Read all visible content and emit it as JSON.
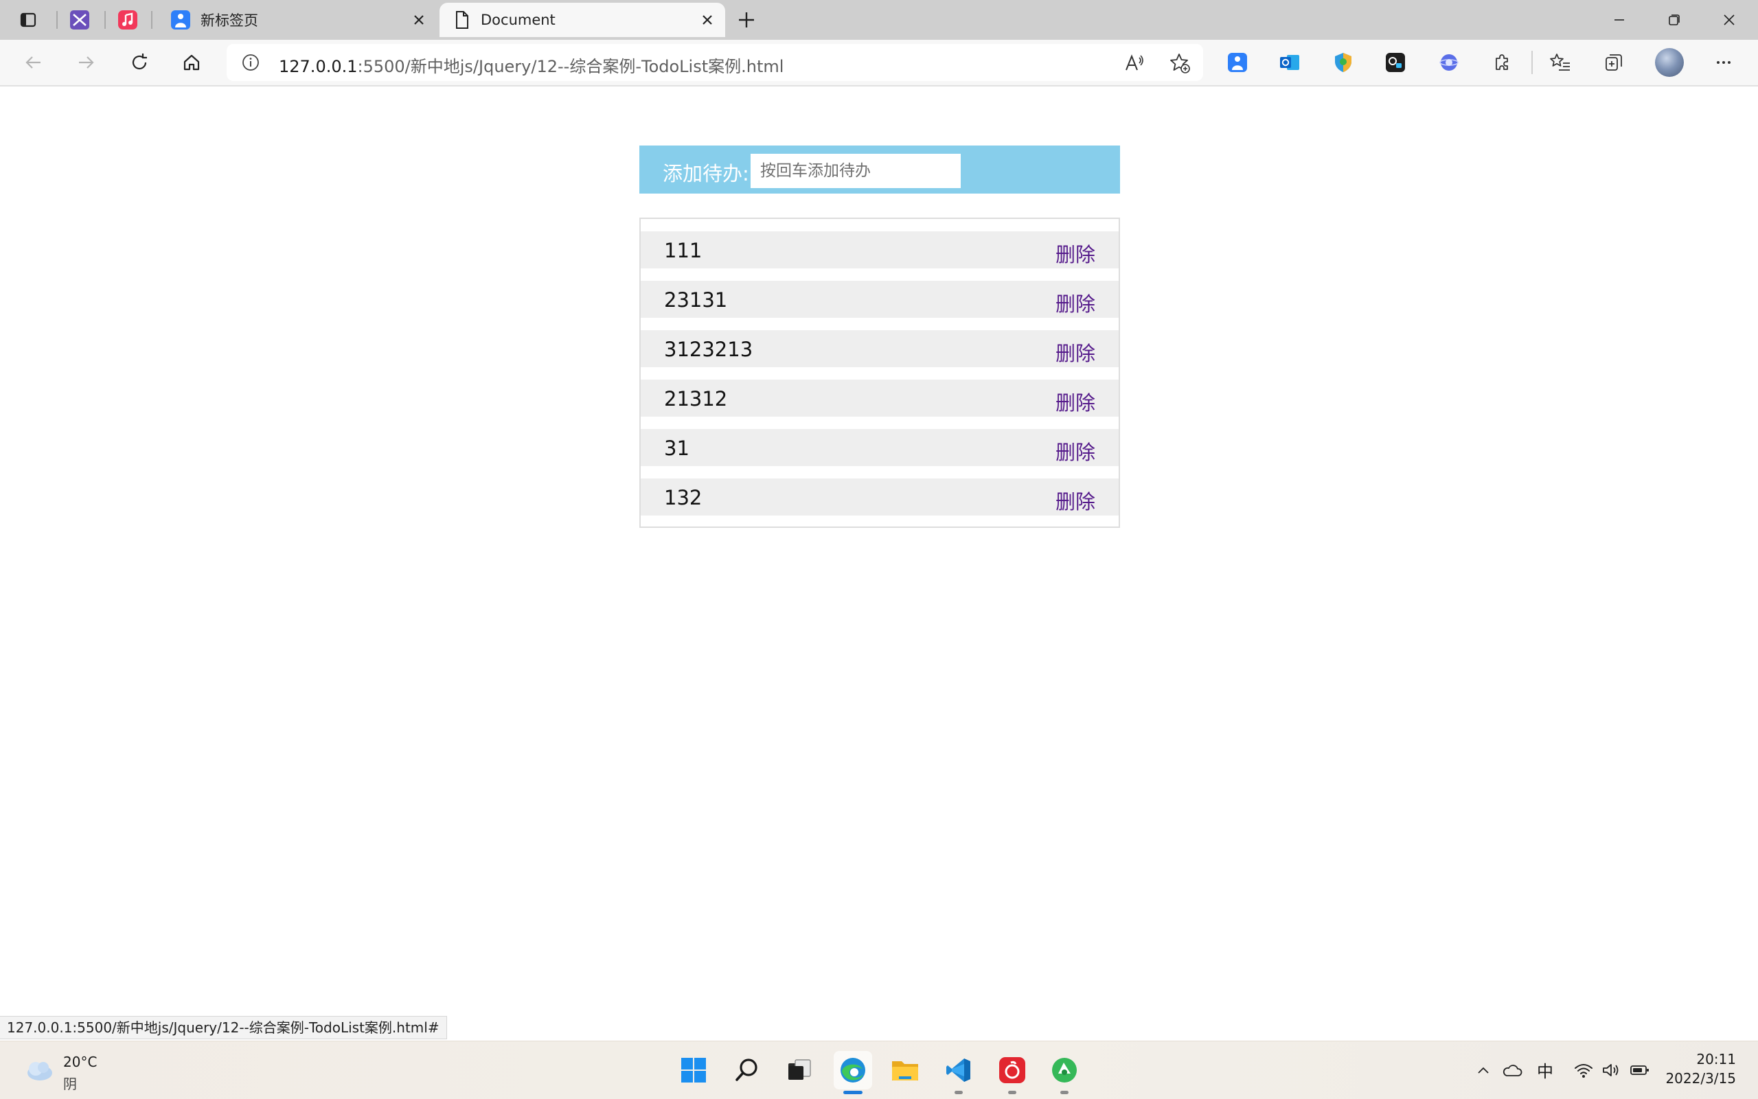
{
  "browser": {
    "tabs": [
      {
        "title": "新标签页",
        "icon": "blue-person-icon",
        "active": false
      },
      {
        "title": "Document",
        "icon": "document-icon",
        "active": true
      }
    ],
    "address": {
      "host": "127.0.0.1",
      "rest": ":5500/新中地js/Jquery/12--综合案例-TodoList案例.html"
    }
  },
  "todo": {
    "label": "添加待办:",
    "placeholder": "按回车添加待办",
    "delete_label": "删除",
    "items": [
      "111",
      "23131",
      "3123213",
      "21312",
      "31",
      "132"
    ],
    "header_color": "#87ceeb",
    "link_color": "#551a8b"
  },
  "status_url": "127.0.0.1:5500/新中地js/Jquery/12--综合案例-TodoList案例.html#",
  "taskbar": {
    "weather_temp": "20°C",
    "weather_cond": "阴",
    "ime": "中",
    "time": "20:11",
    "date": "2022/3/15"
  }
}
